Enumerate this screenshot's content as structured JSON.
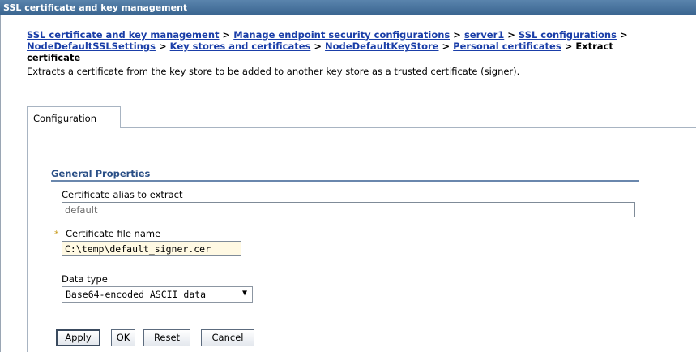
{
  "window": {
    "title": "SSL certificate and key management"
  },
  "breadcrumb": {
    "links": [
      "SSL certificate and key management",
      "Manage endpoint security configurations",
      "server1",
      "SSL configurations",
      "NodeDefaultSSLSettings",
      "Key stores and certificates",
      "NodeDefaultKeyStore",
      "Personal certificates"
    ],
    "separator": ">",
    "current_line1": "Extract",
    "current_line2": "certificate"
  },
  "description": "Extracts a certificate from the key store to be added to another key store as a trusted certificate (signer).",
  "tabs": [
    {
      "label": "Configuration",
      "selected": true
    }
  ],
  "section": {
    "title": "General Properties"
  },
  "fields": {
    "alias": {
      "label": "Certificate alias to extract",
      "value": "default",
      "read_only": true
    },
    "file_name": {
      "label": "Certificate file name",
      "value": "C:\\temp\\default_signer.cer",
      "required": true,
      "required_marker": "*"
    },
    "data_type": {
      "label": "Data type",
      "selected": "Base64-encoded ASCII data",
      "arrow": "▼"
    }
  },
  "buttons": {
    "apply": "Apply",
    "ok": "OK",
    "reset": "Reset",
    "cancel": "Cancel"
  },
  "colors": {
    "titlebar": "#39648f",
    "link": "#1a3ea8",
    "section_title": "#2a4f86",
    "required": "#c79a1a",
    "active_field": "#fff9e3"
  }
}
